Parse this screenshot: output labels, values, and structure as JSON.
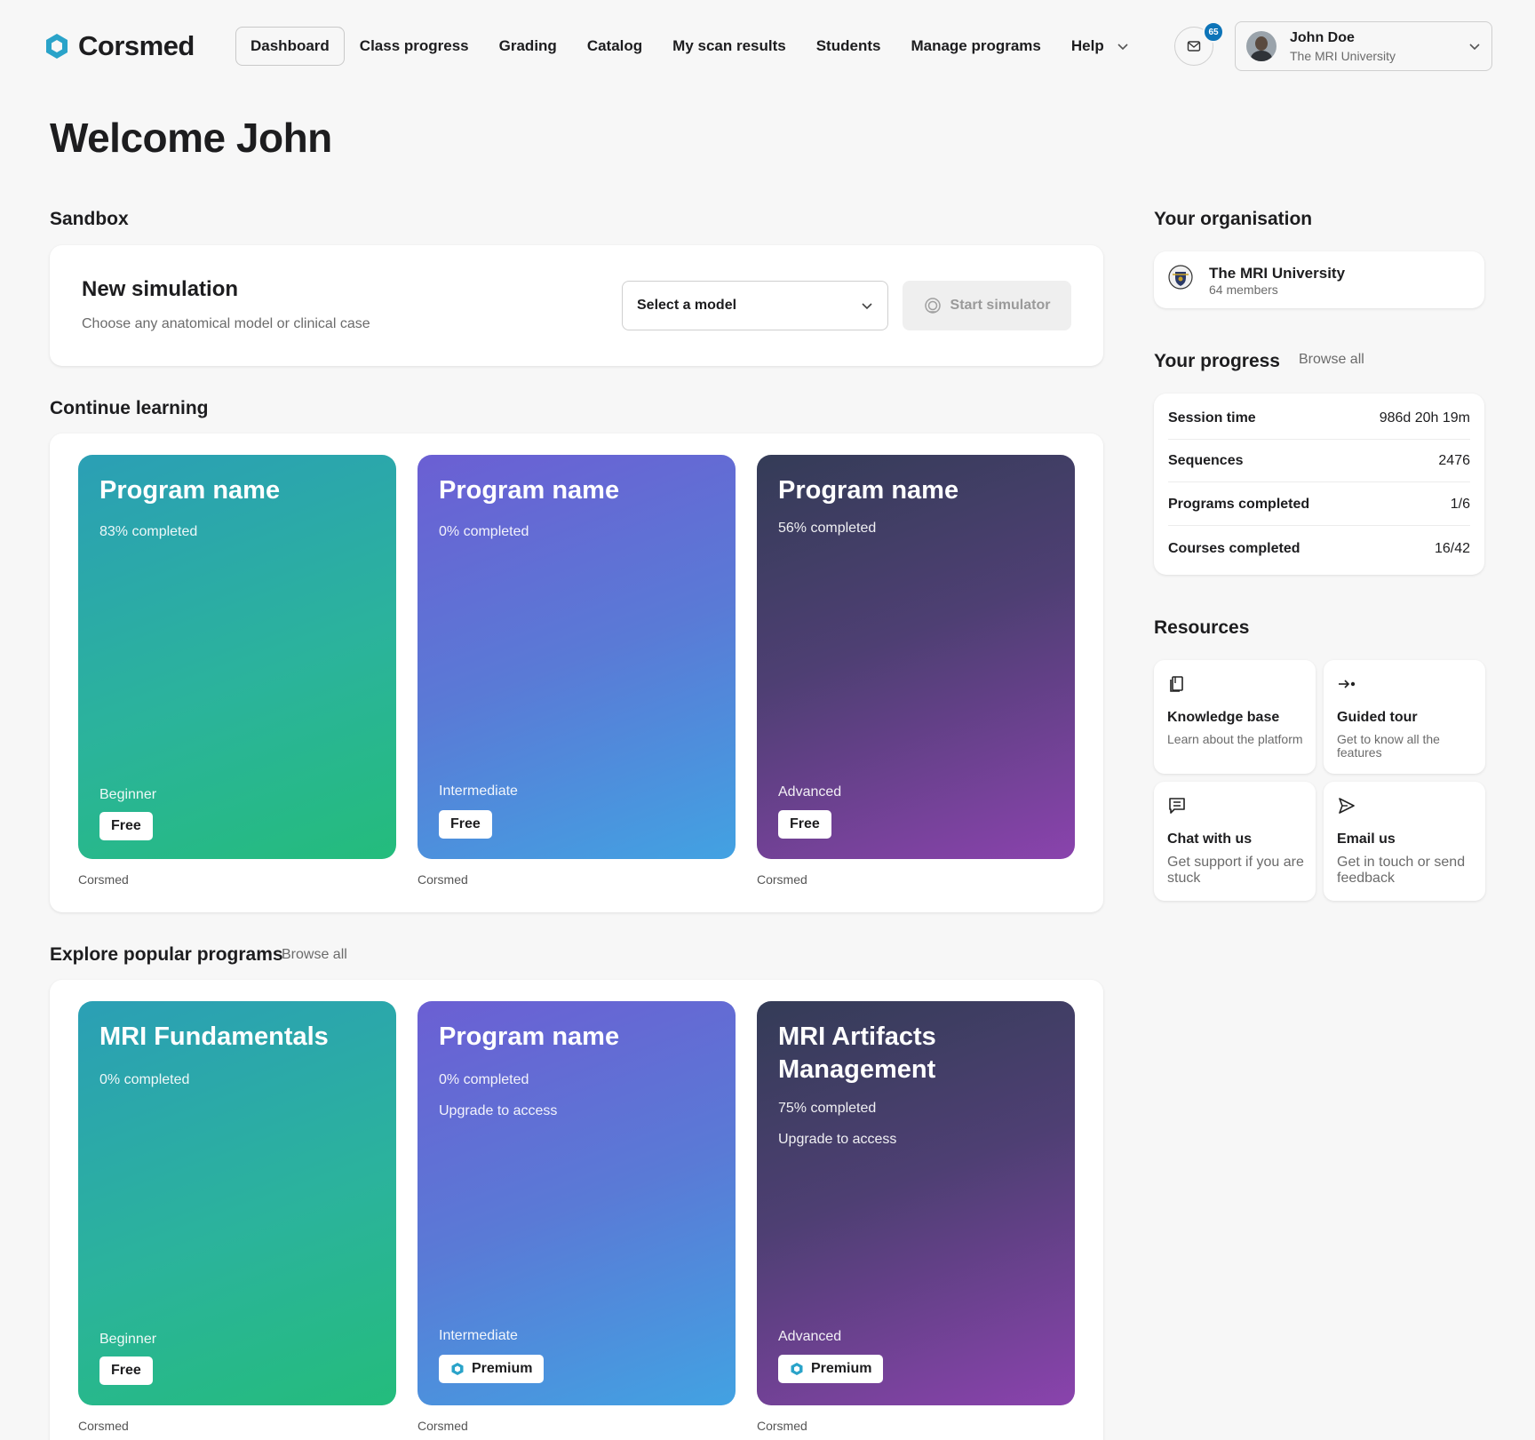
{
  "brand": {
    "name": "Corsmed",
    "accent": "#2aa3c9"
  },
  "nav": {
    "items": [
      {
        "label": "Dashboard",
        "active": true
      },
      {
        "label": "Class progress"
      },
      {
        "label": "Grading"
      },
      {
        "label": "Catalog"
      },
      {
        "label": "My scan results"
      },
      {
        "label": "Students"
      },
      {
        "label": "Manage programs"
      },
      {
        "label": "Help",
        "icon": "chevron-down-icon"
      }
    ]
  },
  "notifications": {
    "count": "65",
    "icon": "mail-icon",
    "badge_color": "#0d74b8"
  },
  "user": {
    "name": "John Doe",
    "org": "The MRI University",
    "icon": "chevron-down-icon"
  },
  "welcome": "Welcome John",
  "sandbox": {
    "section_title": "Sandbox",
    "title": "New simulation",
    "subtitle": "Choose any anatomical model or clinical case",
    "select_label": "Select a model",
    "start_label": "Start simulator",
    "start_icon": "simulator-icon"
  },
  "continue_learning": {
    "section_title": "Continue learning",
    "cards": [
      {
        "title": "Program name",
        "lines": [
          "83% completed"
        ],
        "level": "Beginner",
        "tag": "Free",
        "source": "Corsmed",
        "gradient": "teal"
      },
      {
        "title": "Program name",
        "lines": [
          "0% completed"
        ],
        "level": "Intermediate",
        "tag": "Free",
        "source": "Corsmed",
        "gradient": "blue"
      },
      {
        "title": "Program name",
        "lines": [
          "56% completed"
        ],
        "level": "Advanced",
        "tag": "Free",
        "source": "Corsmed",
        "gradient": "purple"
      }
    ]
  },
  "explore": {
    "section_title": "Explore popular programs",
    "browse_label": "Browse all",
    "cards": [
      {
        "title": "MRI Fundamentals",
        "lines": [
          "0% completed"
        ],
        "level": "Beginner",
        "tag": "Free",
        "source": "Corsmed",
        "gradient": "teal"
      },
      {
        "title": "Program name",
        "lines": [
          "0% completed",
          "Upgrade to access"
        ],
        "level": "Intermediate",
        "tag": "Premium",
        "source": "Corsmed",
        "gradient": "blue"
      },
      {
        "title": "MRI Artifacts Management",
        "lines": [
          "75% completed",
          "Upgrade to access"
        ],
        "level": "Advanced",
        "tag": "Premium",
        "source": "Corsmed",
        "gradient": "purple"
      }
    ]
  },
  "organisation": {
    "section_title": "Your organisation",
    "name": "The MRI University",
    "members": "64 members",
    "icon": "university-crest-icon"
  },
  "progress": {
    "section_title": "Your progress",
    "browse_label": "Browse all",
    "rows": [
      {
        "label": "Session time",
        "value": "986d 20h 19m"
      },
      {
        "label": "Sequences",
        "value": "2476"
      },
      {
        "label": "Programs completed",
        "value": "1/6"
      },
      {
        "label": "Courses completed",
        "value": "16/42"
      }
    ]
  },
  "resources": {
    "section_title": "Resources",
    "items": [
      {
        "title": "Knowledge base",
        "desc": "Learn about the platform",
        "icon": "book-icon"
      },
      {
        "title": "Guided tour",
        "desc": "Get to know all the features",
        "icon": "tour-arrow-icon"
      },
      {
        "title": "Chat with us",
        "desc": "Get support if you are stuck",
        "icon": "chat-icon"
      },
      {
        "title": "Email us",
        "desc": "Get in touch or send feedback",
        "icon": "send-icon"
      }
    ]
  }
}
